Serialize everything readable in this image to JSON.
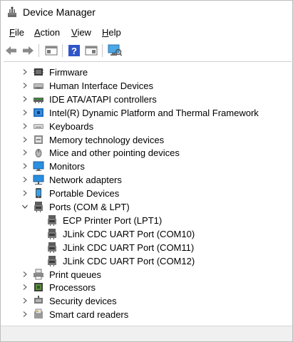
{
  "window": {
    "title": "Device Manager"
  },
  "menu": {
    "file": {
      "mnemonic": "F",
      "rest": "ile"
    },
    "action": {
      "mnemonic": "A",
      "rest": "ction"
    },
    "view": {
      "mnemonic": "V",
      "rest": "iew"
    },
    "help": {
      "mnemonic": "H",
      "rest": "elp"
    }
  },
  "toolbar": {
    "buttons": [
      "back-icon",
      "forward-icon",
      "properties-icon",
      "help-icon",
      "show-hide-console-tree-icon",
      "scan-hardware-icon"
    ]
  },
  "tree": {
    "categories": [
      {
        "label": "Firmware",
        "icon": "firmware-icon",
        "expanded": false
      },
      {
        "label": "Human Interface Devices",
        "icon": "hid-icon",
        "expanded": false
      },
      {
        "label": "IDE ATA/ATAPI controllers",
        "icon": "ide-controller-icon",
        "expanded": false
      },
      {
        "label": "Intel(R) Dynamic Platform and Thermal Framework",
        "icon": "thermal-framework-icon",
        "expanded": false
      },
      {
        "label": "Keyboards",
        "icon": "keyboard-icon",
        "expanded": false
      },
      {
        "label": "Memory technology devices",
        "icon": "memory-device-icon",
        "expanded": false
      },
      {
        "label": "Mice and other pointing devices",
        "icon": "mouse-icon",
        "expanded": false
      },
      {
        "label": "Monitors",
        "icon": "monitor-icon",
        "expanded": false
      },
      {
        "label": "Network adapters",
        "icon": "network-adapter-icon",
        "expanded": false
      },
      {
        "label": "Portable Devices",
        "icon": "portable-device-icon",
        "expanded": false
      },
      {
        "label": "Ports (COM & LPT)",
        "icon": "port-icon",
        "expanded": true
      },
      {
        "label": "ECP Printer Port (LPT1)",
        "icon": "port-icon",
        "child": true
      },
      {
        "label": "JLink CDC UART Port (COM10)",
        "icon": "port-icon",
        "child": true
      },
      {
        "label": "JLink CDC UART Port (COM11)",
        "icon": "port-icon",
        "child": true
      },
      {
        "label": "JLink CDC UART Port (COM12)",
        "icon": "port-icon",
        "child": true
      },
      {
        "label": "Print queues",
        "icon": "printer-icon",
        "expanded": false
      },
      {
        "label": "Processors",
        "icon": "processor-icon",
        "expanded": false
      },
      {
        "label": "Security devices",
        "icon": "security-device-icon",
        "expanded": false
      },
      {
        "label": "Smart card readers",
        "icon": "smart-card-reader-icon",
        "expanded": false
      }
    ]
  }
}
